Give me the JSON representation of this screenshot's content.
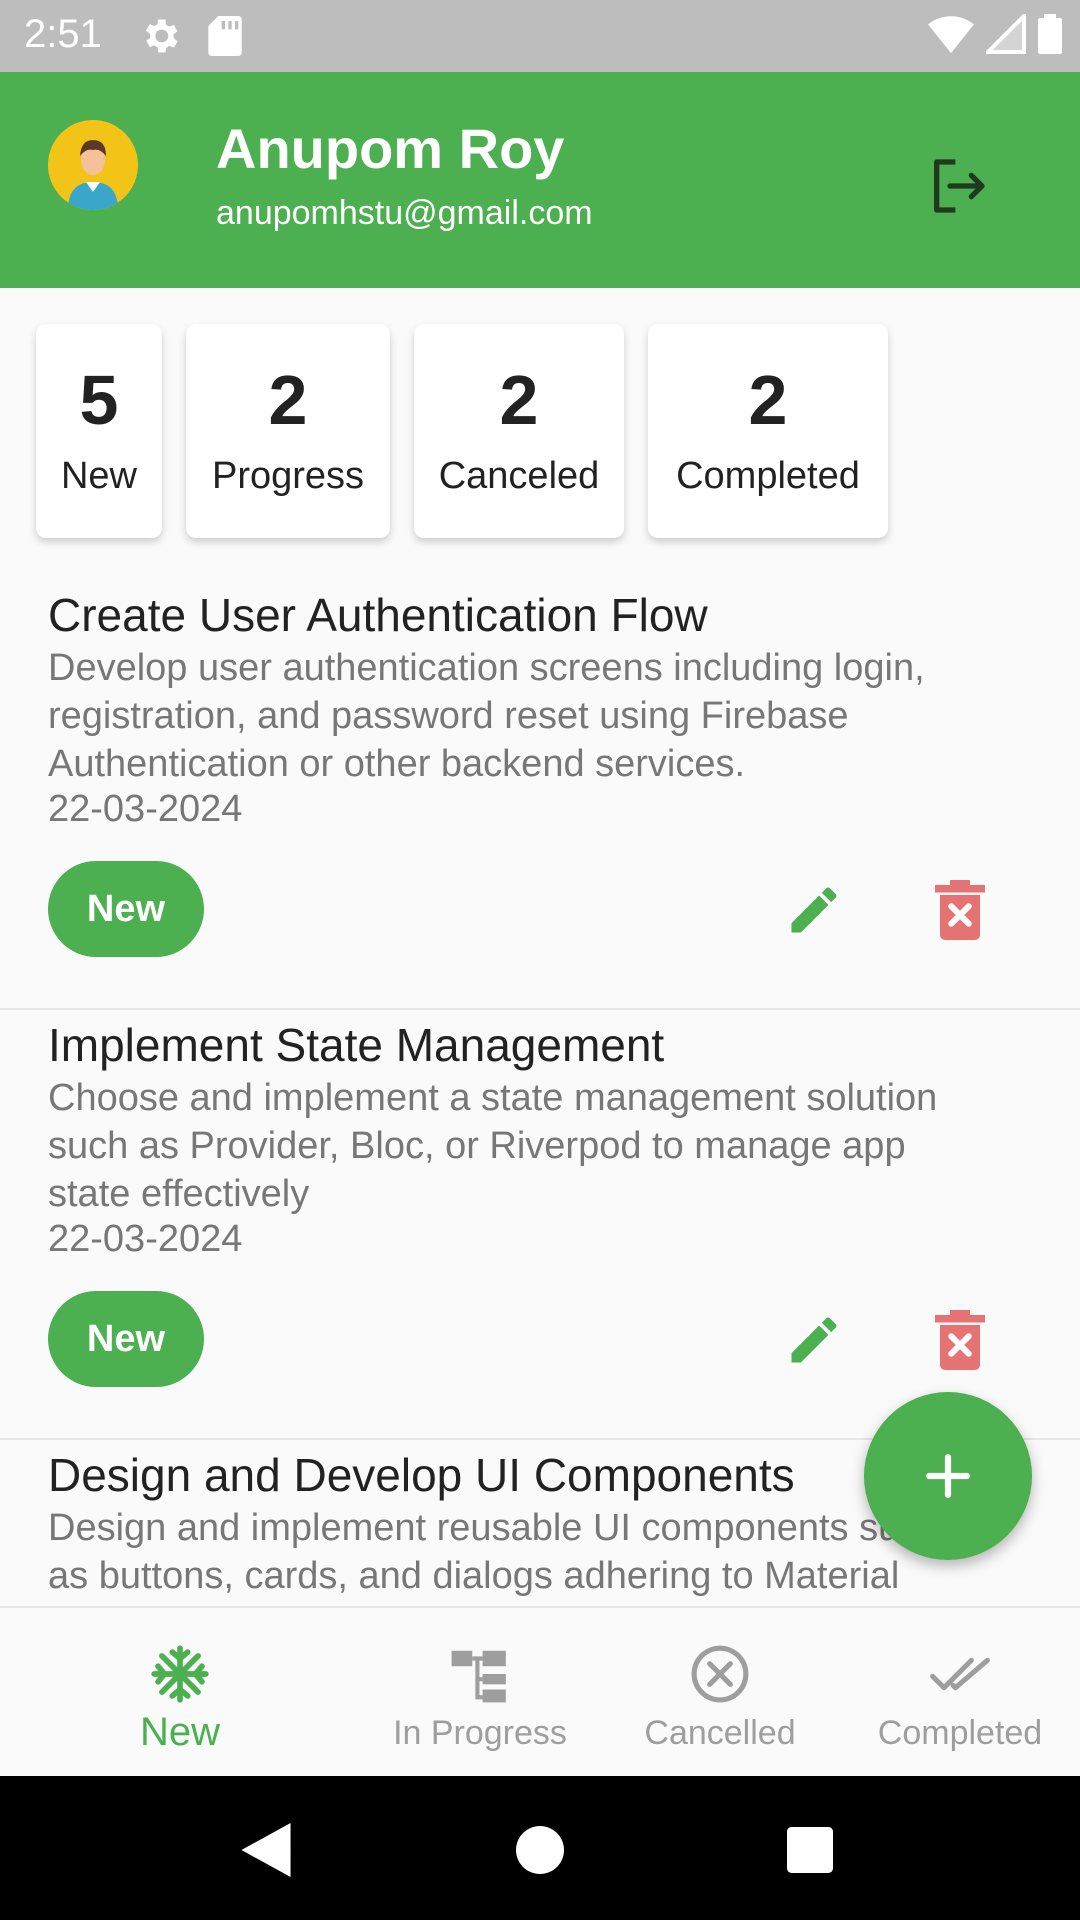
{
  "status_bar": {
    "time": "2:51",
    "icons": [
      "gear-icon",
      "sd-card-icon",
      "wifi-icon",
      "signal-icon",
      "battery-icon"
    ]
  },
  "header": {
    "name": "Anupom Roy",
    "email": "anupomhstu@gmail.com",
    "background_color": "#4caf50"
  },
  "summary": [
    {
      "count": "5",
      "label": "New"
    },
    {
      "count": "2",
      "label": "Progress"
    },
    {
      "count": "2",
      "label": "Canceled"
    },
    {
      "count": "2",
      "label": "Completed"
    }
  ],
  "tasks": [
    {
      "title": "Create User Authentication Flow",
      "description": "Develop user authentication screens including login, registration, and password reset using Firebase Authentication or other backend services.",
      "date": "22-03-2024",
      "status": "New"
    },
    {
      "title": "Implement State Management",
      "description": "Choose and implement a state management solution such as Provider, Bloc, or Riverpod to manage app state effectively",
      "date": "22-03-2024",
      "status": "New"
    },
    {
      "title": "Design and Develop UI Components",
      "description": "Design and implement reusable UI components such as buttons, cards, and dialogs adhering to Material",
      "date": "",
      "status": ""
    }
  ],
  "bottom_nav": [
    {
      "label": "New",
      "icon": "snowflake-icon",
      "active": true
    },
    {
      "label": "In Progress",
      "icon": "hierarchy-icon",
      "active": false
    },
    {
      "label": "Cancelled",
      "icon": "cancel-circle-icon",
      "active": false
    },
    {
      "label": "Completed",
      "icon": "double-check-icon",
      "active": false
    }
  ],
  "colors": {
    "accent": "#4caf50",
    "delete": "#e57373",
    "nav_inactive": "#9e9e9e"
  }
}
